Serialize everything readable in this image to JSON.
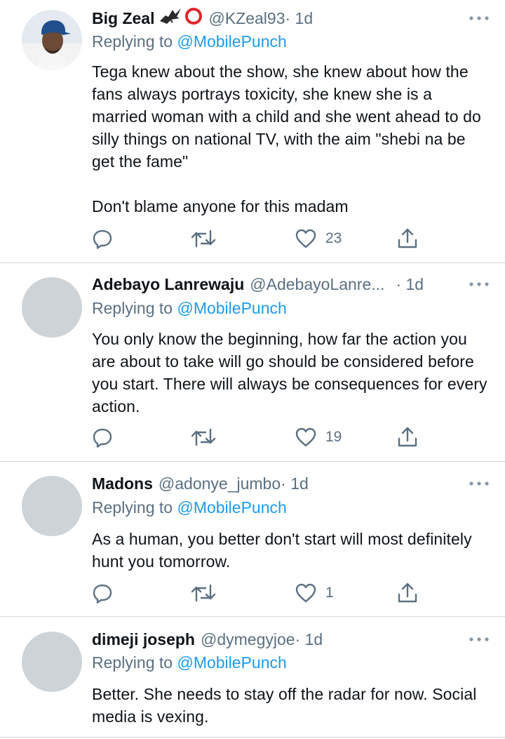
{
  "replying_label": "Replying to",
  "tweets": [
    {
      "name": "Big Zeal",
      "badges": [
        "bird-emoji",
        "red-circle-emoji"
      ],
      "handle": "@KZeal93",
      "time": "· 1d",
      "replying_to": "@MobilePunch",
      "paragraphs": [
        "Tega knew about the show, she knew about how the fans always portrays toxicity, she knew she is a married woman with a child and she went ahead to do silly things on national TV, with the aim \"shebi na be get the fame\"",
        "Don't blame anyone for this madam"
      ],
      "likes": "23",
      "avatar": "profile-photo"
    },
    {
      "name": "Adebayo Lanrewaju",
      "handle": "@AdebayoLanre...",
      "time": "· 1d",
      "replying_to": "@MobilePunch",
      "paragraphs": [
        "You only know the beginning, how far the action you are about to take will go should be considered before you start. There will always be consequences for every action."
      ],
      "likes": "19",
      "avatar": "default-avatar"
    },
    {
      "name": "Madons",
      "handle": "@adonye_jumbo",
      "time": "· 1d",
      "replying_to": "@MobilePunch",
      "paragraphs": [
        "As a human, you better don't start will most definitely hunt you tomorrow."
      ],
      "likes": "1",
      "avatar": "default-avatar"
    },
    {
      "name": "dimeji joseph",
      "handle": "@dymegyjoe",
      "time": "· 1d",
      "replying_to": "@MobilePunch",
      "paragraphs": [
        "Better. She needs to stay off the radar for now. Social media is vexing."
      ],
      "avatar": "default-avatar"
    }
  ],
  "icons": {
    "reply": "reply-icon",
    "retweet": "retweet-icon",
    "like": "heart-icon",
    "share": "share-icon",
    "more": "more-icon"
  },
  "colors": {
    "link": "#1d9bf0",
    "secondary_text": "#5b7083",
    "divider": "#d3d8dc",
    "avatar_placeholder": "#ced3d7"
  }
}
